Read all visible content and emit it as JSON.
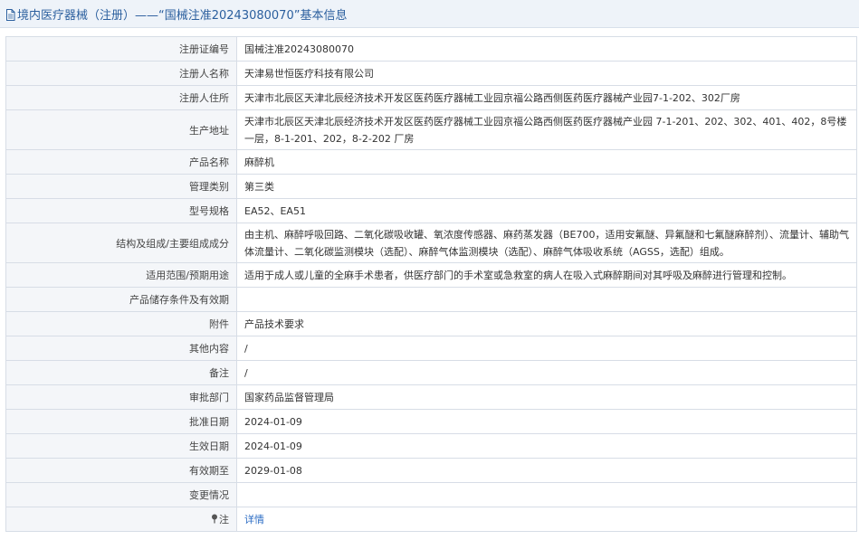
{
  "header": {
    "title": "境内医疗器械（注册）——“国械注准20243080070”基本信息",
    "doc_icon": "document-icon"
  },
  "colors": {
    "title_text": "#2b5f9e",
    "title_bar_bg": "#eef3f9",
    "label_bg": "#f4f6f9",
    "border": "#d7dde6",
    "link": "#2b6cc4"
  },
  "rows": [
    {
      "label": "注册证编号",
      "value": "国械注准20243080070"
    },
    {
      "label": "注册人名称",
      "value": "天津易世恒医疗科技有限公司"
    },
    {
      "label": "注册人住所",
      "value": "天津市北辰区天津北辰经济技术开发区医药医疗器械工业园京福公路西侧医药医疗器械产业园7-1-202、302厂房"
    },
    {
      "label": "生产地址",
      "value": "天津市北辰区天津北辰经济技术开发区医药医疗器械工业园京福公路西侧医药医疗器械产业园 7-1-201、202、302、401、402，8号楼一层，8-1-201、202，8-2-202 厂房"
    },
    {
      "label": "产品名称",
      "value": "麻醉机"
    },
    {
      "label": "管理类别",
      "value": "第三类"
    },
    {
      "label": "型号规格",
      "value": "EA52、EA51"
    },
    {
      "label": "结构及组成/主要组成成分",
      "value": "由主机、麻醉呼吸回路、二氧化碳吸收罐、氧浓度传感器、麻药蒸发器（BE700，适用安氟醚、异氟醚和七氟醚麻醉剂）、流量计、辅助气体流量计、二氧化碳监测模块（选配）、麻醉气体监测模块（选配）、麻醉气体吸收系统（AGSS，选配）组成。"
    },
    {
      "label": "适用范围/预期用途",
      "value": "适用于成人或儿童的全麻手术患者，供医疗部门的手术室或急救室的病人在吸入式麻醉期间对其呼吸及麻醉进行管理和控制。"
    },
    {
      "label": "产品储存条件及有效期",
      "value": ""
    },
    {
      "label": "附件",
      "value": "产品技术要求"
    },
    {
      "label": "其他内容",
      "value": "/"
    },
    {
      "label": "备注",
      "value": "/"
    },
    {
      "label": "审批部门",
      "value": "国家药品监督管理局"
    },
    {
      "label": "批准日期",
      "value": "2024-01-09"
    },
    {
      "label": "生效日期",
      "value": "2024-01-09"
    },
    {
      "label": "有效期至",
      "value": "2029-01-08"
    },
    {
      "label": "变更情况",
      "value": ""
    }
  ],
  "note": {
    "label": "注",
    "icon": "pin-icon",
    "link_text": "详情"
  }
}
